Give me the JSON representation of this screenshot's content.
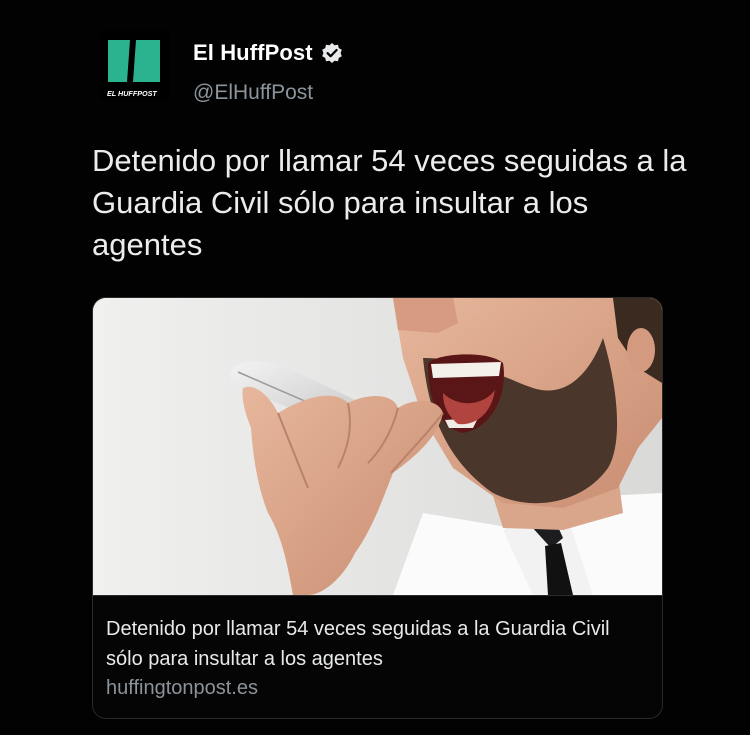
{
  "author": {
    "display_name": "El HuffPost",
    "handle": "@ElHuffPost",
    "verified": true,
    "avatar_label": "EL HUFFPOST",
    "brand_color": "#2bb38f"
  },
  "tweet": {
    "text": "Detenido por llamar 54 veces seguidas a la Guardia Civil sólo para insultar a los agentes"
  },
  "card": {
    "image_icon": "man-shouting-into-phone-photo",
    "title": "Detenido por llamar 54 veces seguidas a la Guardia Civil sólo para insultar a los agentes",
    "domain": "huffingtonpost.es"
  },
  "colors": {
    "background": "#020202",
    "text": "#e7e9ea",
    "secondary_text": "#8b949b",
    "card_border": "#2a2a2a"
  }
}
